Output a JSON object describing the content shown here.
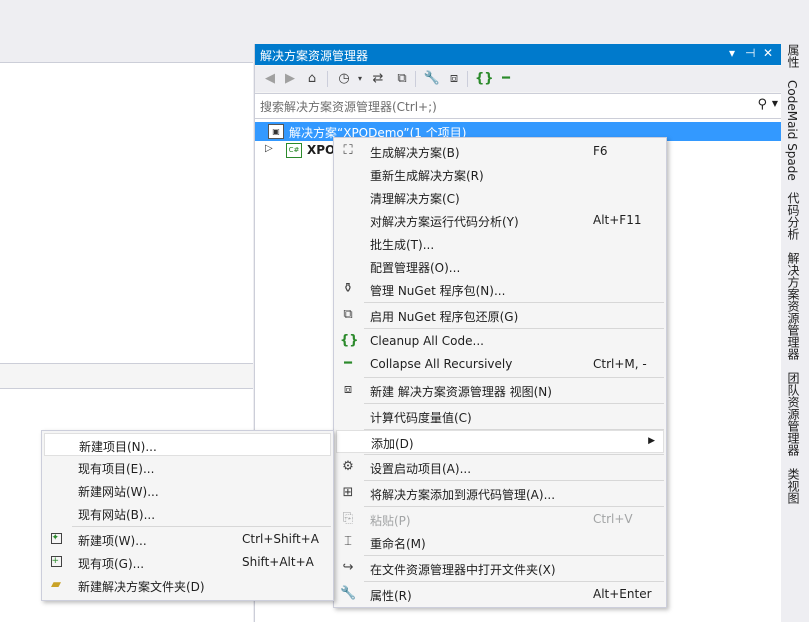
{
  "solution_explorer": {
    "title": "解决方案资源管理器",
    "title_controls": {
      "dropdown": "▾",
      "pin": "⊣",
      "close": "✕"
    },
    "search_placeholder": "搜索解决方案资源管理器(Ctrl+;)",
    "tree": {
      "solution_label": "解决方案“XPODemo”(1 个项目)",
      "project_label": "XPO"
    }
  },
  "toolbar_icons": [
    "back-icon",
    "forward-icon",
    "home-icon",
    "history-icon",
    "sync-icon",
    "collapse-all-icon",
    "properties-icon",
    "preview-icon",
    "cleanup-code-icon",
    "collapse-recursively-icon"
  ],
  "vertical_tabs": [
    "属性",
    "CodeMaid Spade",
    "代码分析",
    "解决方案资源管理器",
    "团队资源管理器",
    "类视图"
  ],
  "context_menu": {
    "items": [
      {
        "label": "生成解决方案(B)",
        "shortcut": "F6",
        "icon": "build-icon"
      },
      {
        "label": "重新生成解决方案(R)",
        "shortcut": "",
        "icon": ""
      },
      {
        "label": "清理解决方案(C)",
        "shortcut": "",
        "icon": ""
      },
      {
        "label": "对解决方案运行代码分析(Y)",
        "shortcut": "Alt+F11",
        "icon": ""
      },
      {
        "label": "批生成(T)...",
        "shortcut": "",
        "icon": ""
      },
      {
        "label": "配置管理器(O)...",
        "shortcut": "",
        "icon": ""
      },
      {
        "label": "管理 NuGet 程序包(N)...",
        "shortcut": "",
        "icon": "nuget-icon"
      },
      {
        "label": "启用 NuGet 程序包还原(G)",
        "shortcut": "",
        "icon": "nuget-restore-icon"
      },
      {
        "label": "Cleanup All Code...",
        "shortcut": "",
        "icon": "cleanup-code-icon"
      },
      {
        "label": "Collapse All Recursively",
        "shortcut": "Ctrl+M, -",
        "icon": "collapse-recursively-icon"
      },
      {
        "label": "新建 解决方案资源管理器 视图(N)",
        "shortcut": "",
        "icon": "new-view-icon"
      },
      {
        "label": "计算代码度量值(C)",
        "shortcut": "",
        "icon": ""
      },
      {
        "label": "添加(D)",
        "shortcut": "",
        "icon": ""
      },
      {
        "label": "设置启动项目(A)...",
        "shortcut": "",
        "icon": "gear-icon"
      },
      {
        "label": "将解决方案添加到源代码管理(A)...",
        "shortcut": "",
        "icon": "source-control-icon"
      },
      {
        "label": "粘贴(P)",
        "shortcut": "Ctrl+V",
        "icon": "paste-icon"
      },
      {
        "label": "重命名(M)",
        "shortcut": "",
        "icon": "rename-icon"
      },
      {
        "label": "在文件资源管理器中打开文件夹(X)",
        "shortcut": "",
        "icon": "open-folder-icon"
      },
      {
        "label": "属性(R)",
        "shortcut": "Alt+Enter",
        "icon": "wrench-icon"
      }
    ]
  },
  "submenu": {
    "items": [
      {
        "label": "新建项目(N)...",
        "shortcut": ""
      },
      {
        "label": "现有项目(E)...",
        "shortcut": ""
      },
      {
        "label": "新建网站(W)...",
        "shortcut": ""
      },
      {
        "label": "现有网站(B)...",
        "shortcut": ""
      },
      {
        "label": "新建项(W)...",
        "shortcut": "Ctrl+Shift+A"
      },
      {
        "label": "现有项(G)...",
        "shortcut": "Shift+Alt+A"
      },
      {
        "label": "新建解决方案文件夹(D)",
        "shortcut": ""
      }
    ]
  },
  "colors": {
    "accent": "#007acc",
    "selection": "#3399ff",
    "menu_bg": "#f5f5f5"
  }
}
